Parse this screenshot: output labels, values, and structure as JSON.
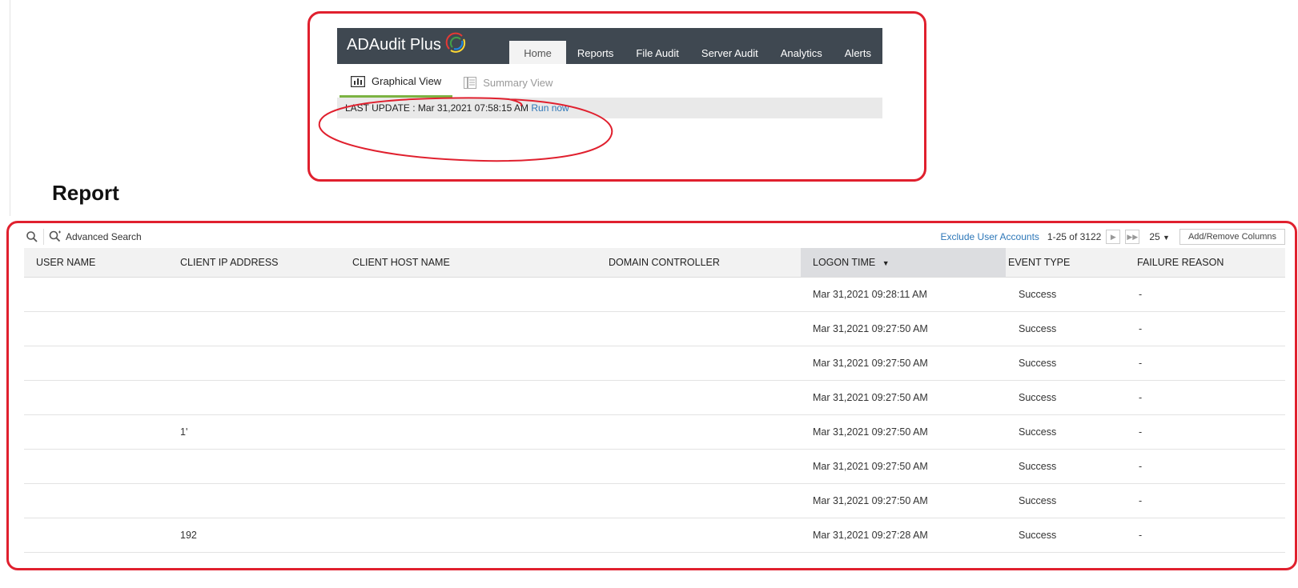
{
  "app": {
    "logo_text": "ADAudit Plus",
    "nav_tabs": [
      "Home",
      "Reports",
      "File Audit",
      "Server Audit",
      "Analytics",
      "Alerts"
    ],
    "active_tab": "Home"
  },
  "views": {
    "graphical": "Graphical View",
    "summary": "Summary View"
  },
  "update": {
    "label": "LAST UPDATE : Mar 31,2021 07:58:15 AM",
    "run_now": "Run now"
  },
  "report": {
    "title": "Report",
    "toolbar": {
      "advanced_search": "Advanced Search",
      "exclude_accounts": "Exclude User Accounts",
      "range": "1-25 of 3122",
      "page_size": "25",
      "add_remove_columns": "Add/Remove Columns"
    },
    "columns": [
      "USER NAME",
      "CLIENT IP ADDRESS",
      "CLIENT HOST NAME",
      "DOMAIN CONTROLLER",
      "LOGON TIME",
      "EVENT TYPE",
      "FAILURE REASON"
    ],
    "sorted_column": "LOGON TIME",
    "rows": [
      {
        "user": "",
        "ip": "",
        "host": "",
        "dc": "",
        "time": "Mar 31,2021 09:28:11 AM",
        "event": "Success",
        "reason": "-"
      },
      {
        "user": "",
        "ip": "",
        "host": "",
        "dc": "",
        "time": "Mar 31,2021 09:27:50 AM",
        "event": "Success",
        "reason": "-"
      },
      {
        "user": "",
        "ip": "",
        "host": "",
        "dc": "",
        "time": "Mar 31,2021 09:27:50 AM",
        "event": "Success",
        "reason": "-"
      },
      {
        "user": "",
        "ip": "",
        "host": "",
        "dc": "",
        "time": "Mar 31,2021 09:27:50 AM",
        "event": "Success",
        "reason": "-"
      },
      {
        "user": "",
        "ip": "1'",
        "host": "",
        "dc": "",
        "time": "Mar 31,2021 09:27:50 AM",
        "event": "Success",
        "reason": "-"
      },
      {
        "user": "",
        "ip": "",
        "host": "",
        "dc": "",
        "time": "Mar 31,2021 09:27:50 AM",
        "event": "Success",
        "reason": "-"
      },
      {
        "user": "",
        "ip": "",
        "host": "",
        "dc": "",
        "time": "Mar 31,2021 09:27:50 AM",
        "event": "Success",
        "reason": "-"
      },
      {
        "user": "",
        "ip": "192",
        "host": "",
        "dc": "",
        "time": "Mar 31,2021 09:27:28 AM",
        "event": "Success",
        "reason": "-"
      }
    ]
  },
  "colors": {
    "annotation": "#e0202e",
    "header_bg": "#3f4851",
    "link": "#2d77b8",
    "active_underline": "#7cb342"
  }
}
